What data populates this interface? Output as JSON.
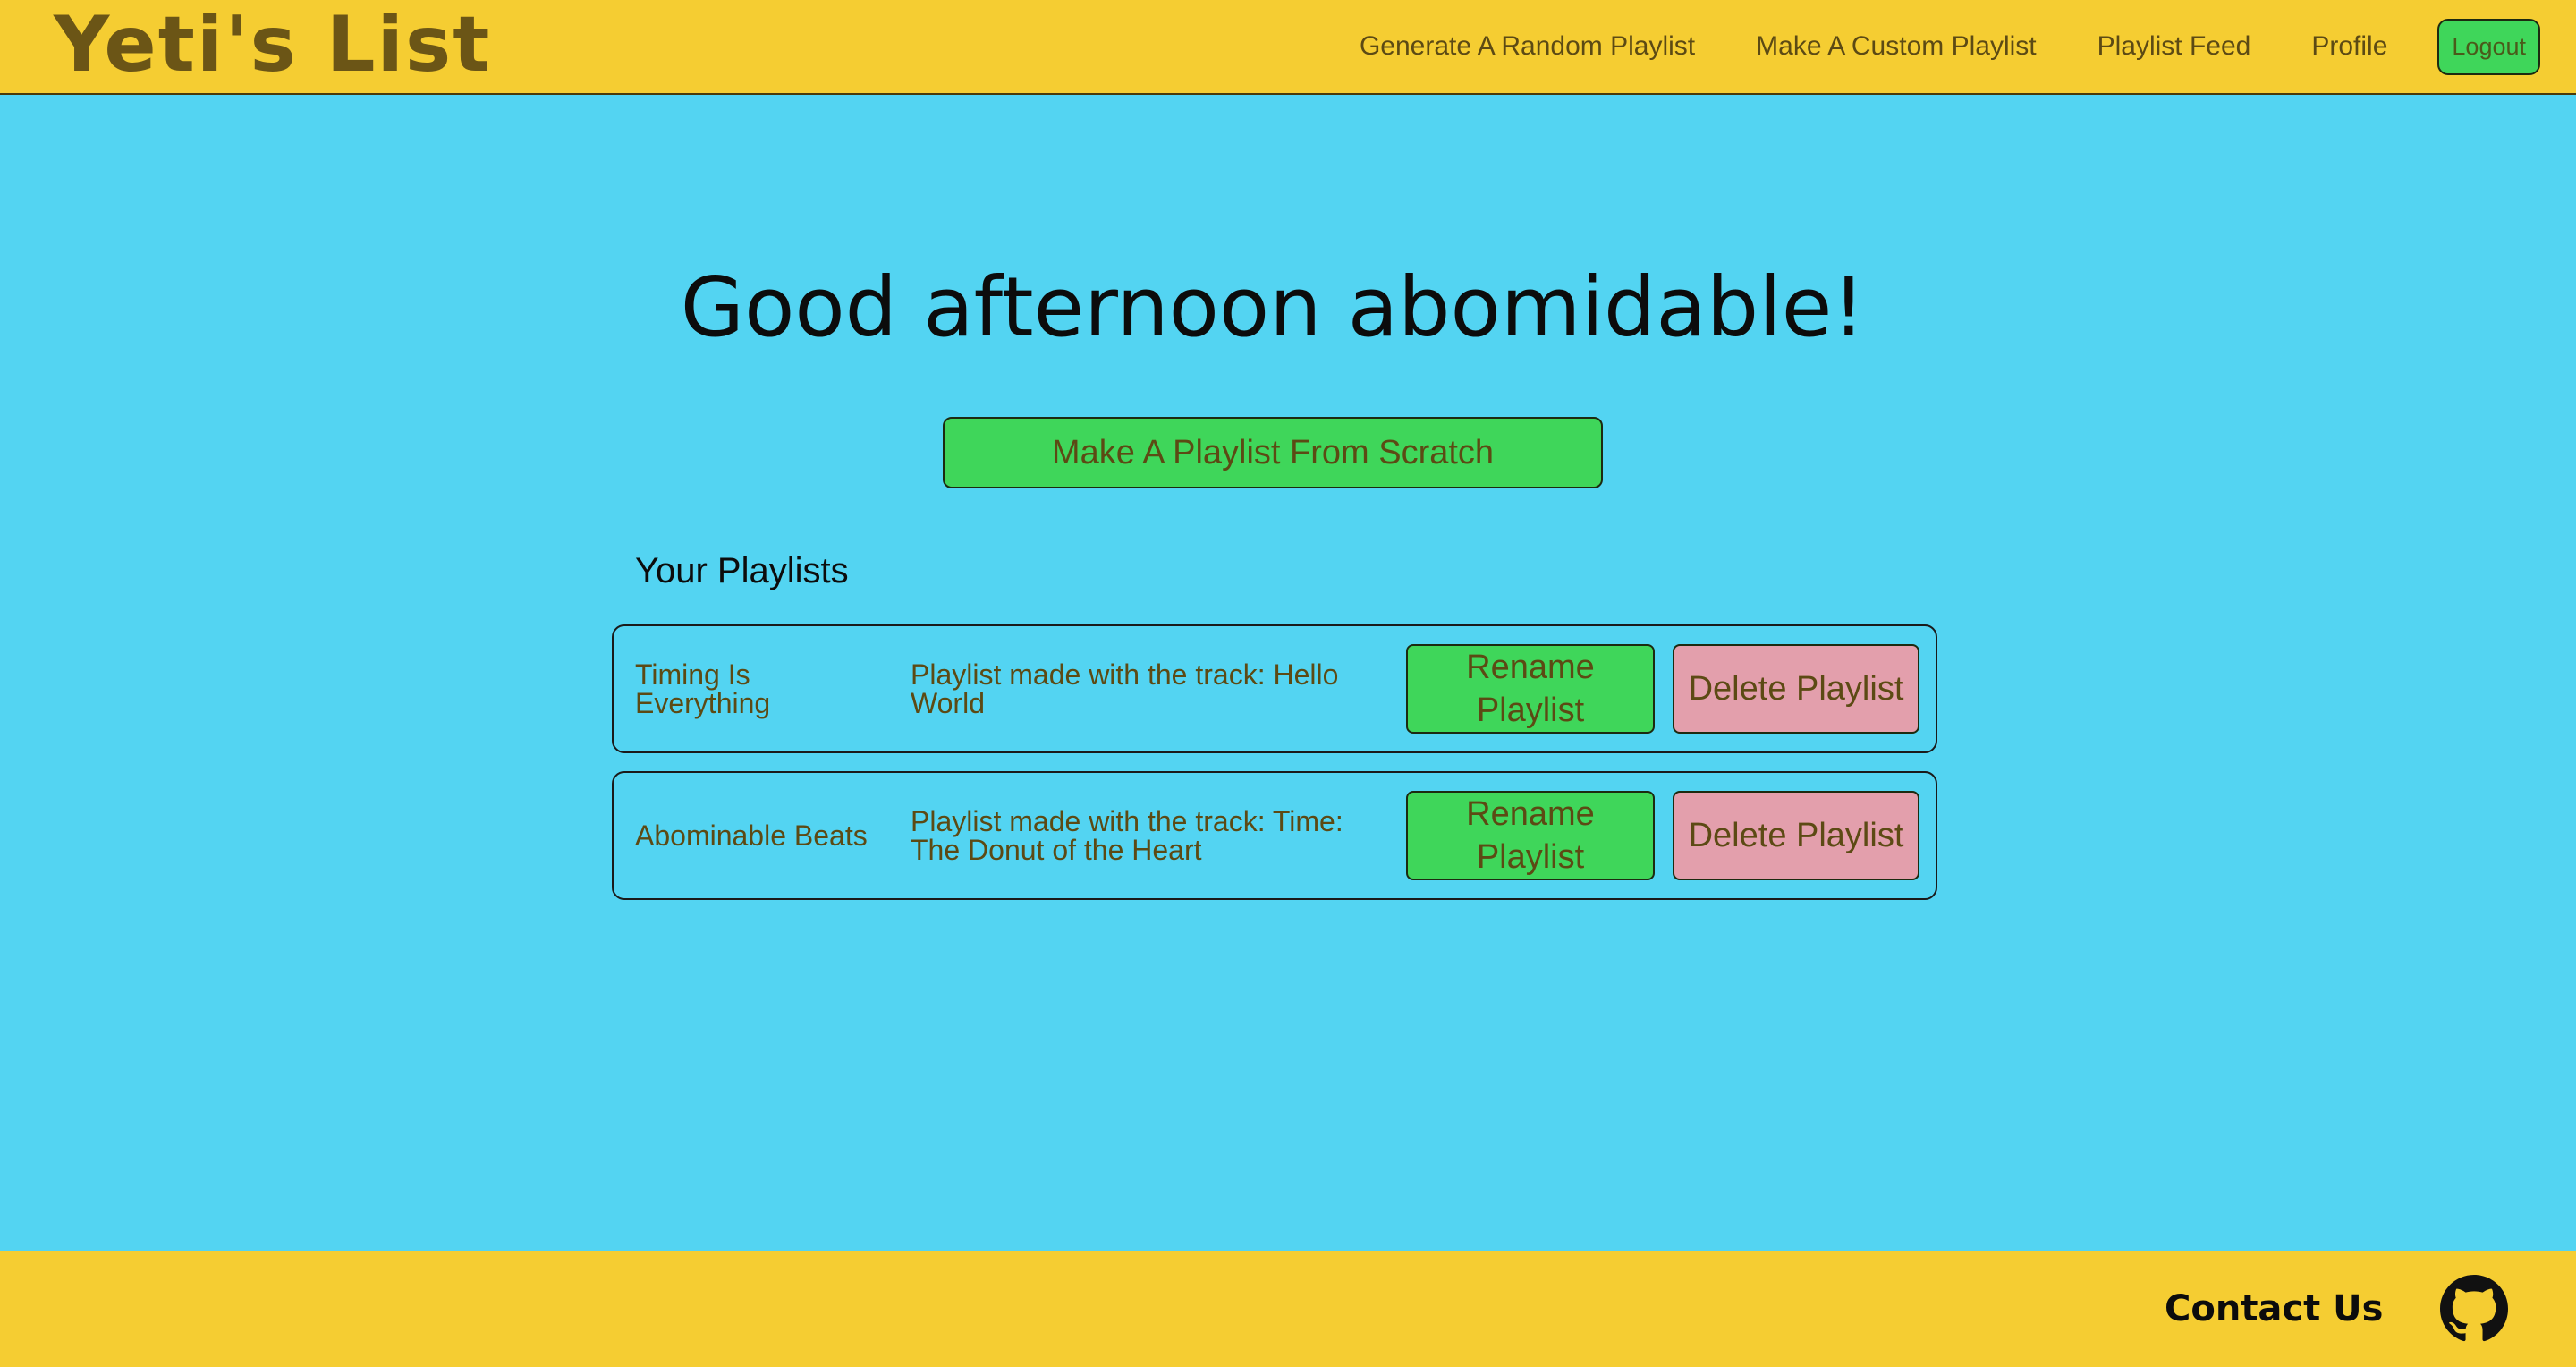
{
  "header": {
    "logo": "Yeti's List",
    "nav": [
      {
        "label": "Generate A Random Playlist"
      },
      {
        "label": "Make A Custom Playlist"
      },
      {
        "label": "Playlist Feed"
      },
      {
        "label": "Profile"
      }
    ],
    "logout_label": "Logout"
  },
  "main": {
    "greeting": "Good afternoon abomidable!",
    "scratch_button": "Make A Playlist From Scratch",
    "section_title": "Your Playlists",
    "playlists": [
      {
        "name": "Timing Is Everything",
        "description": "Playlist made with the track: Hello World",
        "rename_label": "Rename Playlist",
        "delete_label": "Delete Playlist"
      },
      {
        "name": "Abominable Beats",
        "description": "Playlist made with the track: Time: The Donut of the Heart",
        "rename_label": "Rename Playlist",
        "delete_label": "Delete Playlist"
      }
    ]
  },
  "footer": {
    "contact_label": "Contact Us",
    "github_icon": "github-icon"
  },
  "colors": {
    "background": "#53d4f2",
    "header_footer": "#f5cd32",
    "button_green": "#3fd65a",
    "button_pink": "#e39fac",
    "text_brown": "#5c4a14"
  }
}
